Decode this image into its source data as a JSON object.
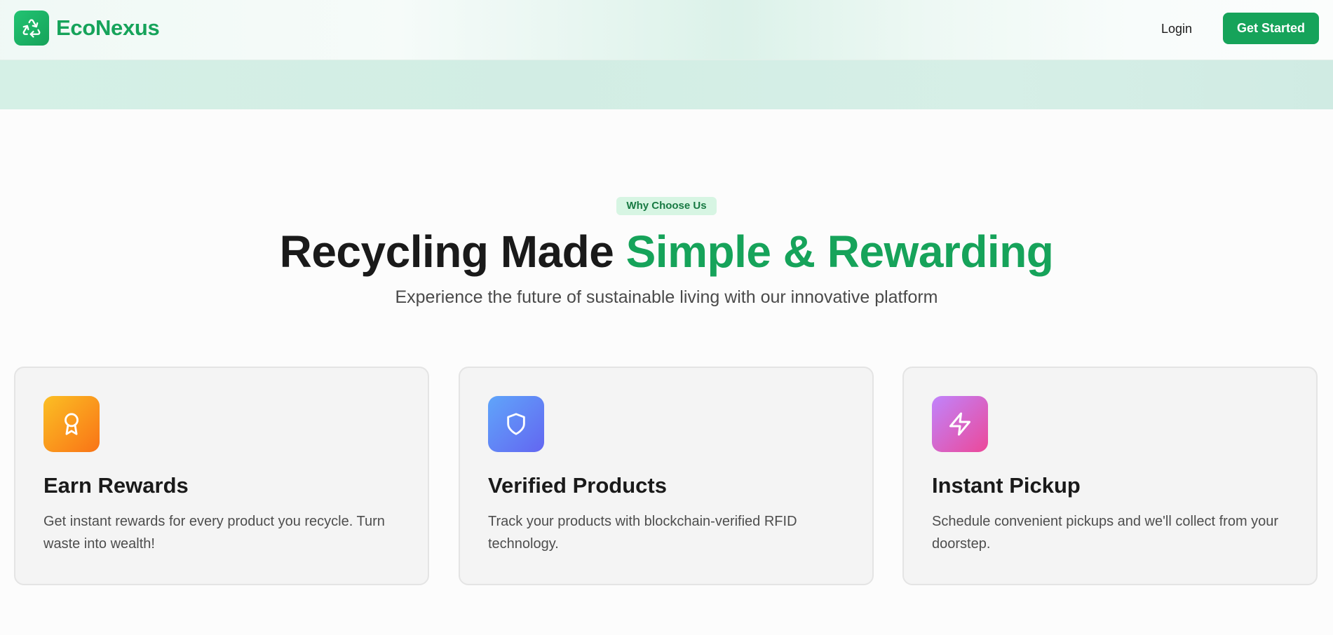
{
  "nav": {
    "brand": "EcoNexus",
    "login_label": "Login",
    "cta_label": "Get Started"
  },
  "section": {
    "eyebrow": "Why Choose Us",
    "headline_plain": "Recycling Made ",
    "headline_accent": "Simple & Rewarding",
    "subhead": "Experience the future of sustainable living with our innovative platform"
  },
  "features": [
    {
      "icon": "award-icon",
      "title": "Earn Rewards",
      "description": "Get instant rewards for every product you recycle. Turn waste into wealth!"
    },
    {
      "icon": "shield-icon",
      "title": "Verified Products",
      "description": "Track your products with blockchain-verified RFID technology."
    },
    {
      "icon": "lightning-icon",
      "title": "Instant Pickup",
      "description": "Schedule convenient pickups and we'll collect from your doorstep."
    }
  ],
  "colors": {
    "brand_green": "#16a35a",
    "rewards_gradient": [
      "#fbbf24",
      "#f97316"
    ],
    "verified_gradient": [
      "#60a5fa",
      "#6366f1"
    ],
    "pickup_gradient": [
      "#c084fc",
      "#ec4899"
    ]
  }
}
